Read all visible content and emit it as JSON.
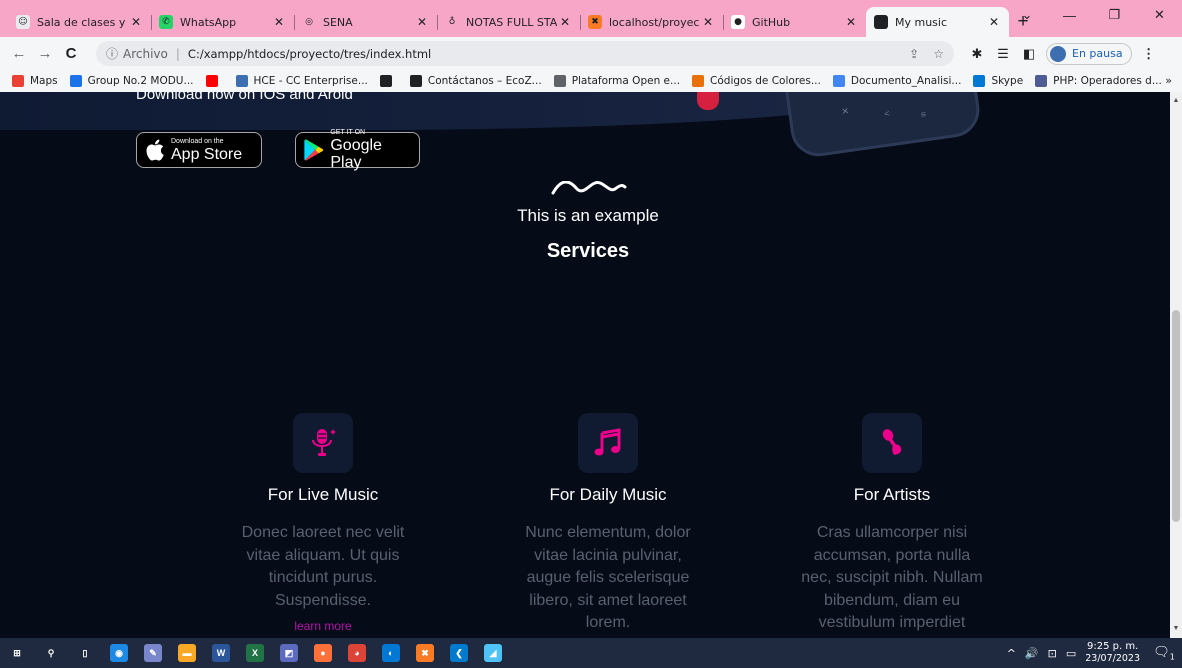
{
  "browser": {
    "tabs": [
      {
        "title": "Sala de clases y t",
        "favicon_color": "#e8eaed",
        "favicon_glyph": "☺",
        "active": false
      },
      {
        "title": "WhatsApp",
        "favicon_color": "#25d366",
        "favicon_glyph": "✆",
        "active": false
      },
      {
        "title": "SENA",
        "favicon_color": "#f7a6c7",
        "favicon_glyph": "◎",
        "active": false
      },
      {
        "title": "NOTAS FULL STA",
        "favicon_color": "#f7a6c7",
        "favicon_glyph": "♁",
        "active": false
      },
      {
        "title": "localhost/proyec",
        "favicon_color": "#fb7a24",
        "favicon_glyph": "✖",
        "active": false
      },
      {
        "title": "GitHub",
        "favicon_color": "#ffffff",
        "favicon_glyph": "●",
        "active": false
      },
      {
        "title": "My music",
        "favicon_color": "#202124",
        "favicon_glyph": "◐",
        "active": true
      }
    ],
    "new_tab": "+",
    "window_controls": {
      "dropdown": "⌄",
      "minimize": "—",
      "restore": "❐",
      "close": "✕"
    },
    "toolbar": {
      "back": "←",
      "forward": "→",
      "reload": "C",
      "info_icon": "ⓘ",
      "site_label": "Archivo",
      "url": "C:/xampp/htdocs/proyecto/tres/index.html",
      "share": "⇪",
      "star": "☆",
      "extensions": "✱",
      "reading_list": "☰",
      "side_panel": "◧",
      "profile_status": "En pausa",
      "menu": "⋮"
    },
    "bookmarks": [
      {
        "label": "Maps",
        "color": "#e94235"
      },
      {
        "label": "Group No.2 MODU...",
        "color": "#1a73e8"
      },
      {
        "label": "",
        "color": "#ff0000"
      },
      {
        "label": "HCE - CC Enterprise...",
        "color": "#3d6fb0"
      },
      {
        "label": "",
        "color": "#202124"
      },
      {
        "label": "Contáctanos – EcoZ...",
        "color": "#202124"
      },
      {
        "label": "Plataforma Open e...",
        "color": "#5f6368"
      },
      {
        "label": "Códigos de Colores...",
        "color": "#e8710a"
      },
      {
        "label": "Documento_Analisi...",
        "color": "#4285f4"
      },
      {
        "label": "Skype",
        "color": "#0078d4"
      },
      {
        "label": "PHP: Operadores d...",
        "color": "#4f5b93"
      }
    ],
    "bookmarks_more": "»"
  },
  "page": {
    "hero_text": "Download now on IOS and Aroid",
    "app_store": {
      "small": "Download on the",
      "big": "App Store"
    },
    "google_play": {
      "small": "GET IT ON",
      "big": "Google Play"
    },
    "example": "This is an example",
    "services": "Services",
    "accent_color": "#ec008c",
    "cards": [
      {
        "icon": "microphone-icon",
        "title": "For Live Music",
        "description": "Donec laoreet nec velit vitae aliquam. Ut quis tincidunt purus. Suspendisse.",
        "link": "learn more"
      },
      {
        "icon": "music-note-icon",
        "title": "For Daily Music",
        "description": "Nunc elementum, dolor vitae lacinia pulvinar, augue felis scelerisque libero, sit amet laoreet lorem.",
        "link": ""
      },
      {
        "icon": "singer-mic-icon",
        "title": "For Artists",
        "description": "Cras ullamcorper nisi accumsan, porta nulla nec, suscipit nibh. Nullam bibendum, diam eu vestibulum imperdiet",
        "link": ""
      }
    ]
  },
  "taskbar": {
    "apps": [
      {
        "name": "start",
        "glyph": "⊞",
        "color": "transparent"
      },
      {
        "name": "search",
        "glyph": "⚲",
        "color": "transparent"
      },
      {
        "name": "task-view",
        "glyph": "▯",
        "color": "transparent"
      },
      {
        "name": "app-blue",
        "glyph": "◉",
        "color": "#1e88e5"
      },
      {
        "name": "app-paint",
        "glyph": "✎",
        "color": "#7986cb"
      },
      {
        "name": "file-explorer",
        "glyph": "▬",
        "color": "#f9a825"
      },
      {
        "name": "word",
        "glyph": "W",
        "color": "#2b579a"
      },
      {
        "name": "excel",
        "glyph": "X",
        "color": "#217346"
      },
      {
        "name": "app-network",
        "glyph": "◩",
        "color": "#5c6bc0"
      },
      {
        "name": "firefox",
        "glyph": "●",
        "color": "#ff7139"
      },
      {
        "name": "chrome",
        "glyph": "◕",
        "color": "#db4437"
      },
      {
        "name": "edge",
        "glyph": "◐",
        "color": "#0078d4"
      },
      {
        "name": "xampp",
        "glyph": "✖",
        "color": "#fb7a24"
      },
      {
        "name": "vscode",
        "glyph": "❮",
        "color": "#007acc"
      },
      {
        "name": "app-pen",
        "glyph": "◢",
        "color": "#4fc3f7"
      }
    ],
    "tray": {
      "chevron": "^",
      "volume": "🔊",
      "network": "⊡",
      "battery": "▭",
      "time": "9:25 p. m.",
      "date": "23/07/2023",
      "notifications": "🗨",
      "notif_count": "1"
    }
  }
}
